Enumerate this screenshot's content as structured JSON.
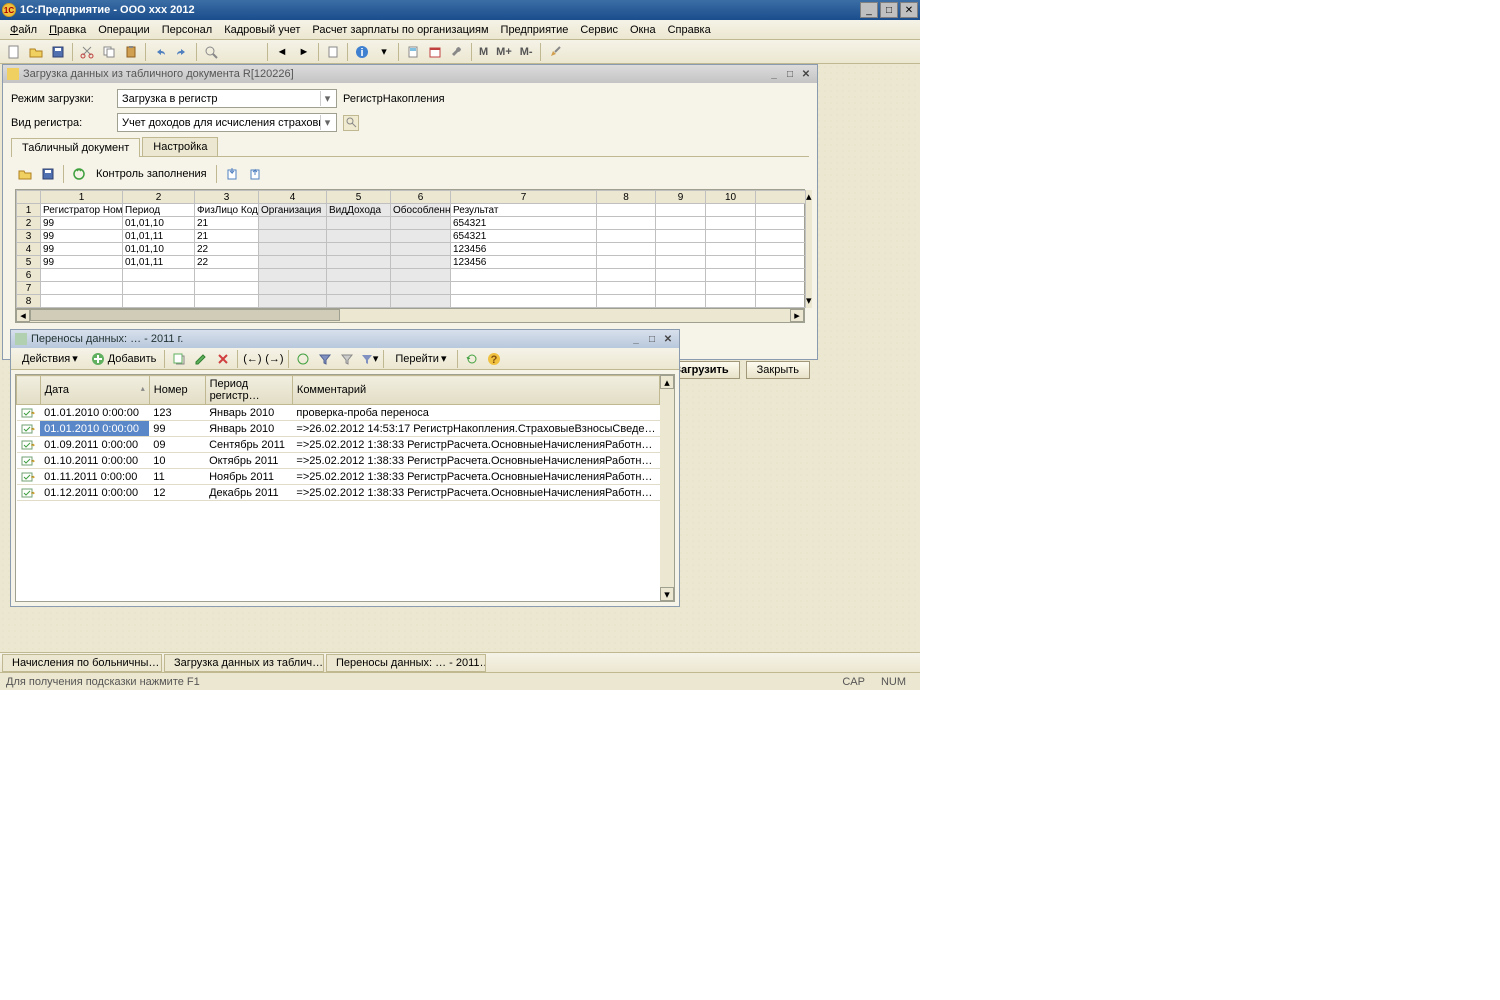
{
  "titlebar": {
    "app_title": "1С:Предприятие - ООО ххх 2012"
  },
  "menu": [
    "Файл",
    "Правка",
    "Операции",
    "Персонал",
    "Кадровый учет",
    "Расчет зарплаты по организациям",
    "Предприятие",
    "Сервис",
    "Окна",
    "Справка"
  ],
  "loader_window": {
    "title": "Загрузка данных из табличного документа R[120226]",
    "mode_label": "Режим загрузки:",
    "mode_value": "Загрузка в регистр",
    "mode_link": "РегистрНакопления",
    "reg_label": "Вид регистра:",
    "reg_value": "Учет доходов для исчисления страховых",
    "tabs": [
      "Табличный документ",
      "Настройка"
    ],
    "check_btn": "Контроль заполнения",
    "load_btn": "Загрузить",
    "close_btn": "Закрыть",
    "cols": [
      "1",
      "2",
      "3",
      "4",
      "5",
      "6",
      "7",
      "8",
      "9",
      "10"
    ],
    "headers": [
      "Регистратор Ном",
      "Период",
      "ФизЛицо Код",
      "Организация",
      "ВидДохода",
      "ОбособленноеПодразделение",
      "Результат",
      "",
      "",
      ""
    ],
    "rows": [
      [
        "99",
        "01,01,10",
        "21",
        "",
        "",
        "",
        "654321",
        "",
        "",
        ""
      ],
      [
        "99",
        "01,01,11",
        "21",
        "",
        "",
        "",
        "654321",
        "",
        "",
        ""
      ],
      [
        "99",
        "01,01,10",
        "22",
        "",
        "",
        "",
        "123456",
        "",
        "",
        ""
      ],
      [
        "99",
        "01,01,11",
        "22",
        "",
        "",
        "",
        "123456",
        "",
        "",
        ""
      ],
      [
        "",
        "",
        "",
        "",
        "",
        "",
        "",
        "",
        "",
        ""
      ],
      [
        "",
        "",
        "",
        "",
        "",
        "",
        "",
        "",
        "",
        ""
      ],
      [
        "",
        "",
        "",
        "",
        "",
        "",
        "",
        "",
        "",
        ""
      ]
    ]
  },
  "transfer_window": {
    "title": "Переносы данных: … - 2011 г.",
    "actions_btn": "Действия",
    "add_btn": "Добавить",
    "goto_btn": "Перейти",
    "columns": [
      "",
      "Дата",
      "Номер",
      "Период регистр…",
      "Комментарий"
    ],
    "rows": [
      {
        "date": "01.01.2010 0:00:00",
        "num": "123",
        "period": "Январь 2010",
        "comment": "проверка-проба переноса",
        "sel": false
      },
      {
        "date": "01.01.2010 0:00:00",
        "num": "99",
        "period": "Январь 2010",
        "comment": "=>26.02.2012 14:53:17 РегистрНакопления.СтраховыеВзносыСведе…",
        "sel": true
      },
      {
        "date": "01.09.2011 0:00:00",
        "num": "09",
        "period": "Сентябрь 2011",
        "comment": "=>25.02.2012 1:38:33 РегистрРасчета.ОсновныеНачисленияРаботн…",
        "sel": false
      },
      {
        "date": "01.10.2011 0:00:00",
        "num": "10",
        "period": "Октябрь 2011",
        "comment": "=>25.02.2012 1:38:33 РегистрРасчета.ОсновныеНачисленияРаботн…",
        "sel": false
      },
      {
        "date": "01.11.2011 0:00:00",
        "num": "11",
        "period": "Ноябрь 2011",
        "comment": "=>25.02.2012 1:38:33 РегистрРасчета.ОсновныеНачисленияРаботн…",
        "sel": false
      },
      {
        "date": "01.12.2011 0:00:00",
        "num": "12",
        "period": "Декабрь 2011",
        "comment": "=>25.02.2012 1:38:33 РегистрРасчета.ОсновныеНачисленияРаботн…",
        "sel": false
      }
    ]
  },
  "taskbar": [
    "Начисления по больничны…",
    "Загрузка данных из таблич…",
    "Переносы данных: … - 2011…"
  ],
  "statusbar": {
    "hint": "Для получения подсказки нажмите F1",
    "cap": "CAP",
    "num": "NUM"
  }
}
